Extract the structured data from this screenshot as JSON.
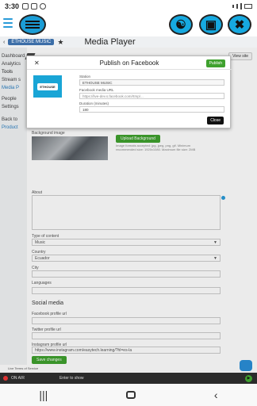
{
  "status_bar": {
    "time": "3:30"
  },
  "header": {
    "fab_icons": [
      "users-swap-icon",
      "screen-share-icon",
      "close-x-icon"
    ]
  },
  "page": {
    "topbar_button": "ETHOUSE MUSIC",
    "title": "Media Player",
    "view_button": "View site",
    "sidebar": [
      {
        "label": "Dashboard"
      },
      {
        "label": "Analytics"
      },
      {
        "label": "Tools"
      },
      {
        "label": "Stream s"
      },
      {
        "label": "Media P"
      },
      {
        "label": "People"
      },
      {
        "label": "Settings"
      },
      {
        "label": "Back to"
      },
      {
        "label": "Product"
      }
    ],
    "background_image_label": "Background image",
    "upload_background": "Upload Background",
    "bg_note": "Image formats accepted: jpg, jpeg, png, gif. Minimum recommended size: 1920x1080. Maximum file size: 2MB",
    "about_label": "About",
    "type_of_content_label": "Type of content",
    "type_of_content_value": "Music",
    "country_label": "Country",
    "country_value": "Ecuador",
    "city_label": "City",
    "languages_label": "Languages",
    "social_title": "Social media",
    "facebook_label": "Facebook profile url",
    "twitter_label": "Twitter profile url",
    "instagram_label": "Instagram profile url",
    "instagram_value": "https://www.instagram.com/easytech.learning/?hl=es-la",
    "save_button": "Save changes",
    "footer_text": "Live Terms of Service",
    "player_station": "ON AIR",
    "player_text": "Enter to show"
  },
  "modal": {
    "title": "Publish on Facebook",
    "publish_button": "Publish",
    "logo_text": "ETHOUSE",
    "station_label": "Station",
    "station_value": "ETHOUSE MUSIC",
    "fb_url_label": "Facebook media URL",
    "fb_url_placeholder": "https://live-dev.s.facebook.com/rtmp/...",
    "duration_label": "Duration (minutes)",
    "duration_value": "180",
    "close_button": "Close"
  }
}
